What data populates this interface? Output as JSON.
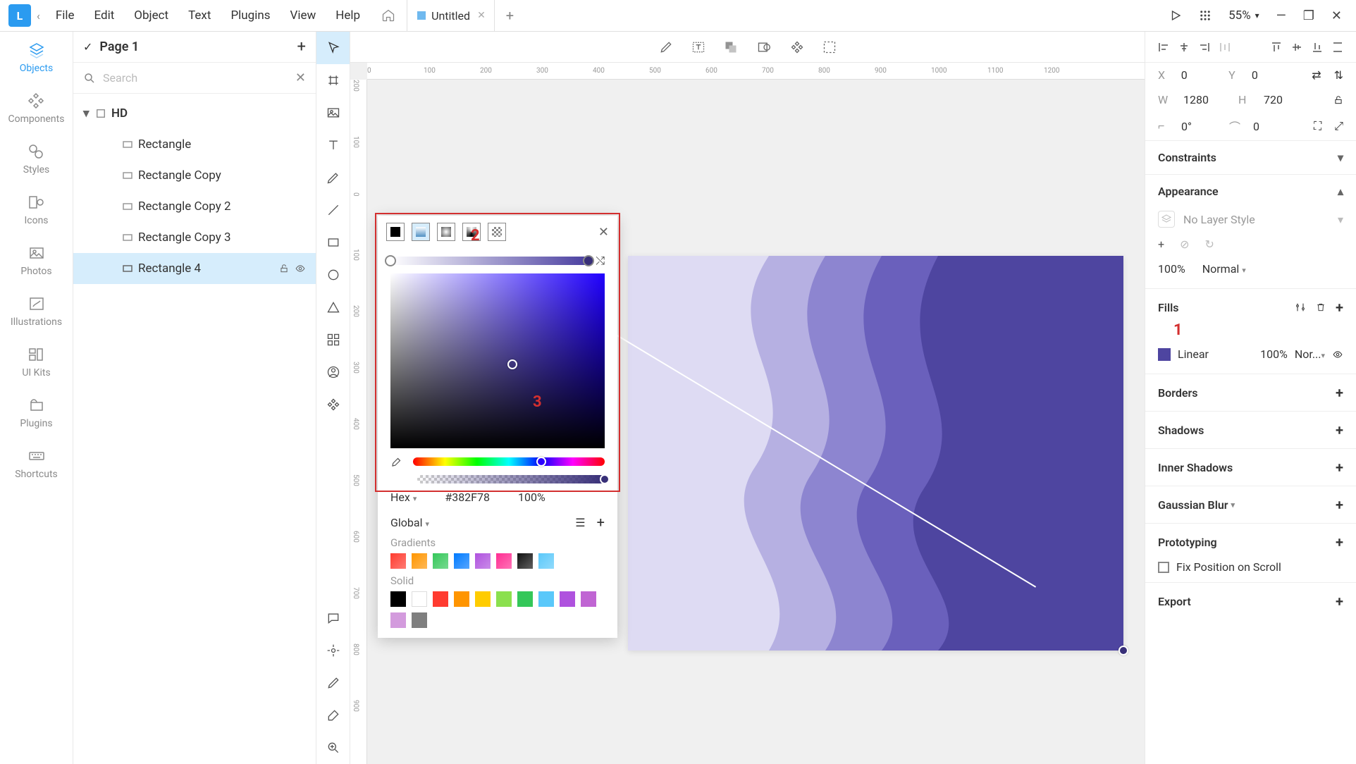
{
  "menubar": {
    "items": [
      "File",
      "Edit",
      "Object",
      "Text",
      "Plugins",
      "View",
      "Help"
    ],
    "tab_title": "Untitled",
    "zoom": "55%"
  },
  "leftbar": {
    "items": [
      "Objects",
      "Components",
      "Styles",
      "Icons",
      "Photos",
      "Illustrations",
      "UI Kits",
      "Plugins",
      "Shortcuts"
    ]
  },
  "layers": {
    "page": "Page 1",
    "search_placeholder": "Search",
    "tree": [
      {
        "name": "HD",
        "type": "frame",
        "expanded": true
      },
      {
        "name": "Rectangle",
        "type": "rect"
      },
      {
        "name": "Rectangle Copy",
        "type": "rect"
      },
      {
        "name": "Rectangle Copy 2",
        "type": "rect"
      },
      {
        "name": "Rectangle Copy 3",
        "type": "rect"
      },
      {
        "name": "Rectangle 4",
        "type": "rect",
        "selected": true
      }
    ]
  },
  "inspector": {
    "x": "0",
    "y": "0",
    "w": "1280",
    "h": "720",
    "rotation": "0°",
    "corner": "0",
    "constraints": "Constraints",
    "appearance": {
      "title": "Appearance",
      "layer_style": "No Layer Style",
      "opacity": "100%",
      "blend": "Normal"
    },
    "fills": {
      "title": "Fills",
      "type": "Linear",
      "opacity": "100%",
      "blend": "Nor...",
      "swatch_color": "#4e45a0"
    },
    "borders": "Borders",
    "shadows": "Shadows",
    "inner_shadows": "Inner Shadows",
    "blur": "Gaussian Blur",
    "prototyping": {
      "title": "Prototyping",
      "fix": "Fix Position on Scroll"
    },
    "export": "Export"
  },
  "color_picker": {
    "hex_label": "Hex",
    "hex": "#382F78",
    "alpha": "100%",
    "global": "Global",
    "gradients_label": "Gradients",
    "solid_label": "Solid",
    "gradient_swatches": [
      "#ff3b2f",
      "#ff9500",
      "#34c759",
      "#007aff",
      "#af52de",
      "#ff2d92",
      "#111111",
      "#5ac8fa"
    ],
    "solid_swatches": [
      "#000000",
      "#ffffff",
      "#ff3b30",
      "#ff9500",
      "#ffcc00",
      "#8be04e",
      "#34c759",
      "#5ac8fa",
      "#af52de",
      "#c065d3",
      "#d39bdd",
      "#7f7f7f"
    ]
  },
  "ruler": {
    "h_ticks": [
      "0",
      "100",
      "200",
      "300",
      "400",
      "500",
      "600",
      "700",
      "800",
      "900",
      "1000",
      "1100",
      "1200"
    ],
    "v_ticks": [
      "200",
      "100",
      "0",
      "100",
      "200",
      "300",
      "400",
      "500",
      "600",
      "700",
      "800",
      "900"
    ]
  },
  "annotations": {
    "a1": "1",
    "a2": "2",
    "a3": "3"
  },
  "artboard_colors": {
    "layers": [
      "#dedbf3",
      "#b6b0e2",
      "#8d85d0",
      "#6a60bc",
      "#4e45a0"
    ]
  }
}
